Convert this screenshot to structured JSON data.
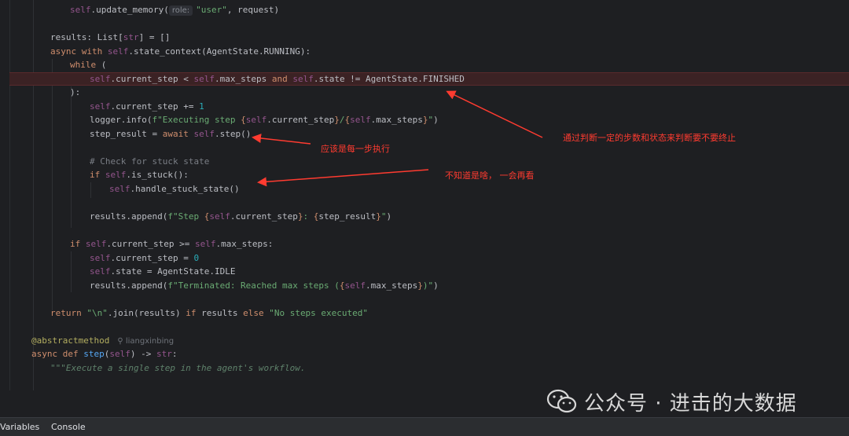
{
  "code": {
    "l1": {
      "self": "self",
      "call": ".update_memory(",
      "hint": "role:",
      "str": "\"user\"",
      "rest": ", request)"
    },
    "l2": {
      "text": "results: List[",
      "type": "str",
      "rest": "] = []"
    },
    "l3": {
      "kw1": "async",
      "kw2": "with",
      "self": "self",
      "rest": ".state_context(AgentState.RUNNING):"
    },
    "l4": {
      "kw": "while",
      "rest": " ("
    },
    "l5": {
      "self1": "self",
      "a": ".current_step < ",
      "self2": "self",
      "b": ".max_steps ",
      "kw": "and",
      "self3": "self",
      "c": ".state != AgentState.FINISHED"
    },
    "l6": {
      "text": "):"
    },
    "l7": {
      "self": "self",
      "a": ".current_step += ",
      "num": "1"
    },
    "l8": {
      "a": "logger.info(",
      "s1": "f\"Executing step ",
      "b1": "{",
      "self1": "self",
      "c1": ".current_step",
      "b2": "}",
      "s2": "/",
      "b3": "{",
      "self2": "self",
      "c2": ".max_steps",
      "b4": "}",
      "s3": "\"",
      "end": ")"
    },
    "l9": {
      "a": "step_result = ",
      "kw": "await",
      "self": "self",
      "b": ".step()"
    },
    "l10": {
      "text": "# Check for stuck state"
    },
    "l11": {
      "kw": "if",
      "self": "self",
      "rest": ".is_stuck():"
    },
    "l12": {
      "self": "self",
      "rest": ".handle_stuck_state()"
    },
    "l13": {
      "a": "results.append(",
      "s1": "f\"Step ",
      "b1": "{",
      "self": "self",
      "c": ".current_step",
      "b2": "}",
      "s2": ": ",
      "b3": "{",
      "v": "step_result",
      "b4": "}",
      "s3": "\"",
      "end": ")"
    },
    "l14": {
      "kw": "if",
      "self1": "self",
      "a": ".current_step >= ",
      "self2": "self",
      "b": ".max_steps:"
    },
    "l15": {
      "self": "self",
      "a": ".current_step = ",
      "num": "0"
    },
    "l16": {
      "self": "self",
      "a": ".state = AgentState.IDLE"
    },
    "l17": {
      "a": "results.append(",
      "s1": "f\"Terminated: Reached max steps (",
      "b1": "{",
      "self": "self",
      "c": ".max_steps",
      "b2": "}",
      "s2": ")\"",
      "end": ")"
    },
    "l18": {
      "kw": "return",
      "s1": "\"\\n\"",
      "a": ".join(results) ",
      "kw2": "if",
      "b": " results ",
      "kw3": "else",
      "s2": "\"No steps executed\""
    },
    "l19": {
      "deco": "@abstractmethod",
      "author": "liangxinbing"
    },
    "l20": {
      "kw1": "async",
      "kw2": "def",
      "fn": "step",
      "a": "(",
      "self": "self",
      "b": ") -> ",
      "type": "str",
      "c": ":"
    },
    "l21": {
      "doc": "\"\"\"Execute a single step in the agent's workflow."
    }
  },
  "annotations": {
    "a1": "通过判断一定的步数和状态来判断要不要终止",
    "a2": "应该是每一步执行",
    "a3": "不知道是啥，  一会再看"
  },
  "bottom_tabs": {
    "variables": "Variables",
    "console": "Console"
  },
  "watermark": {
    "text": "公众号 · 进击的大数据",
    "icon": "wechat-icon"
  },
  "colors": {
    "background": "#1e1f22",
    "keyword": "#cf8e6d",
    "self": "#94558d",
    "string": "#6aab73",
    "annotation": "#ff3b30"
  }
}
